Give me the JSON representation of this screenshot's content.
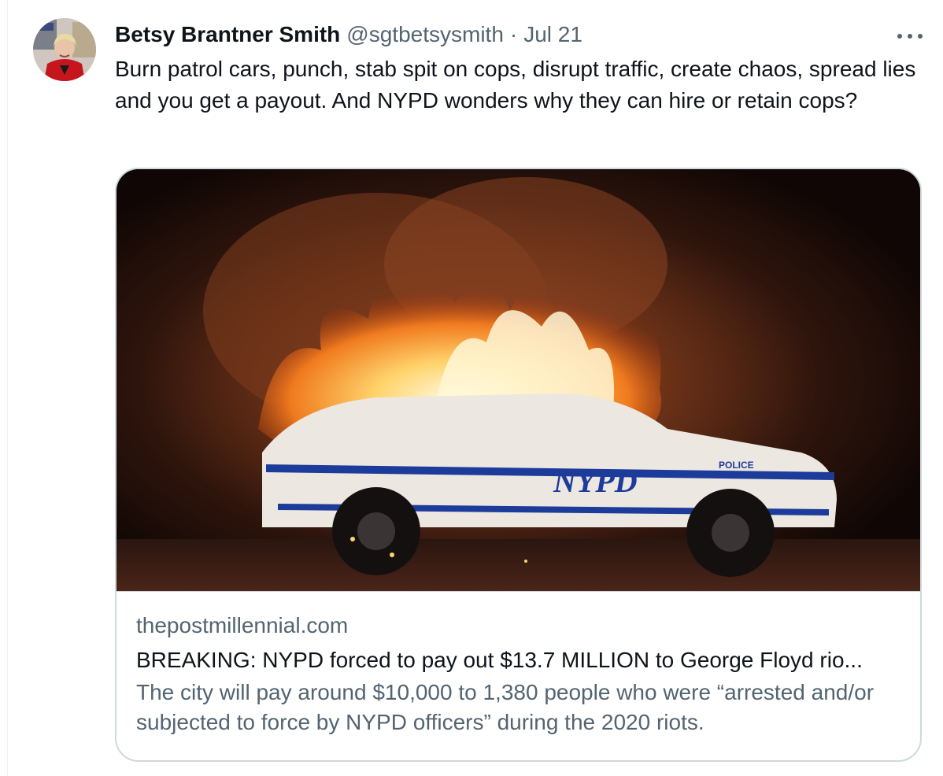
{
  "tweet": {
    "author": {
      "display_name": "Betsy Brantner Smith",
      "handle": "@sgtbetsysmith",
      "avatar_icon": "profile-photo"
    },
    "date": "Jul 21",
    "separator": "·",
    "more_icon": "ellipsis-icon",
    "text": "Burn patrol cars, punch, stab spit on cops, disrupt traffic, create chaos, spread lies and you get a payout. And NYPD wonders why they can hire or retain cops?",
    "card": {
      "image_alt": "Burning NYPD patrol car at night",
      "image_text_vehicle": "NYPD",
      "image_text_police": "POLICE",
      "domain": "thepostmillennial.com",
      "title": "BREAKING: NYPD forced to pay out $13.7 MILLION to George Floyd rio...",
      "description": "The city will pay around $10,000 to 1,380 people who were “arrested and/or subjected to force by NYPD officers” during the 2020 riots."
    }
  },
  "colors": {
    "primary_text": "#0f1419",
    "secondary_text": "#536471",
    "border": "#cfd9de"
  }
}
